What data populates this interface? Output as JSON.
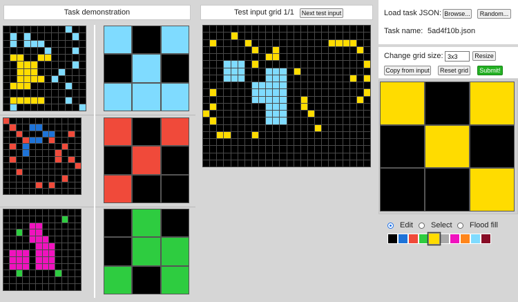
{
  "colors": [
    "#000000",
    "#1e73d8",
    "#f04a3a",
    "#2ecc40",
    "#ffdc00",
    "#aaaaaa",
    "#f012be",
    "#ff851b",
    "#7fdbff",
    "#870c25"
  ],
  "demo": {
    "title": "Task demonstration",
    "pairs": [
      {
        "input": {
          "rows": 12,
          "cols": 12,
          "cells": [
            "000000000800",
            "080800000080",
            "080888000000",
            "000000800080",
            "044004400000",
            "004440000080",
            "004440008000",
            "004444080000",
            "044400000800",
            "000000000000",
            "044444000800",
            "080000000008"
          ]
        },
        "output": {
          "rows": 3,
          "cols": 3,
          "cells": [
            "808",
            "080",
            "888"
          ]
        }
      },
      {
        "input": {
          "rows": 12,
          "cols": 12,
          "cells": [
            "200000000000",
            "020011000000",
            "002000110020",
            "000211020000",
            "020100000200",
            "000100002000",
            "020000002020",
            "000000000002",
            "002000000000",
            "000000000200",
            "000002020000",
            "000000000000"
          ]
        },
        "output": {
          "rows": 3,
          "cols": 3,
          "cells": [
            "202",
            "020",
            "200"
          ]
        }
      },
      {
        "input": {
          "rows": 12,
          "cols": 12,
          "cells": [
            "000000000000",
            "000000000300",
            "000066000000",
            "003066000000",
            "000066600000",
            "000006660000",
            "066606660000",
            "066606660000",
            "066606660000",
            "003000003000",
            "000000000000",
            "000000000000"
          ]
        },
        "output": {
          "rows": 3,
          "cols": 3,
          "cells": [
            "030",
            "033",
            "303"
          ]
        }
      }
    ]
  },
  "test": {
    "title": "Test input grid 1/1",
    "next_button": "Next test input",
    "grid": {
      "rows": 20,
      "cols": 24,
      "cells": [
        "000000000000000000000000",
        "000040000000000000000000",
        "040000400000000000444400",
        "000000040040000000000040",
        "000000000440000000000000",
        "000888040000000000000004",
        "000888000888040000000000",
        "000888000888000000000404",
        "000000088888000000000000",
        "040000088888000000000004",
        "000000088888004000000040",
        "040000000888004000000000",
        "400000000888000400000000",
        "040000000888000000000000",
        "000000000000000040000000",
        "004400040000000000000000",
        "000000000000000000000000",
        "000000000000000000000000",
        "000000000000000000000000",
        "000000000000000000000000"
      ]
    }
  },
  "load": {
    "label": "Load task JSON:",
    "browse": "Browse...",
    "random": "Random...",
    "task_name_label": "Task name:",
    "task_name": "5ad4f10b.json"
  },
  "controls": {
    "size_label": "Change grid size:",
    "size_value": "3x3",
    "resize": "Resize",
    "copy": "Copy from input",
    "reset": "Reset grid",
    "submit": "Submit!"
  },
  "output_grid": {
    "rows": 3,
    "cols": 3,
    "cells": [
      "404",
      "040",
      "004"
    ]
  },
  "modes": {
    "edit": "Edit",
    "select": "Select",
    "flood": "Flood fill",
    "selected": "edit"
  },
  "palette_selected": 4
}
